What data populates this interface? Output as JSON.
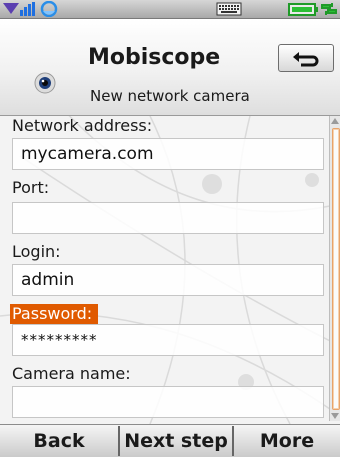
{
  "status_bar": {
    "icons": [
      "signal-strength-icon",
      "keyboard-icon",
      "battery-icon"
    ]
  },
  "header": {
    "title": "Mobiscope",
    "subtitle": "New network camera",
    "app_icon": "camera-eye-icon",
    "back_icon": "return-arrow-icon"
  },
  "form": {
    "fields": [
      {
        "label": "Network address:",
        "value": "mycamera.com"
      },
      {
        "label": "Port:",
        "value": ""
      },
      {
        "label": "Login:",
        "value": "admin"
      },
      {
        "label": "Password:",
        "value": "*********",
        "focused": true
      },
      {
        "label": "Camera name:",
        "value": ""
      }
    ]
  },
  "softkeys": {
    "left": "Back",
    "middle": "Next step",
    "right": "More"
  },
  "colors": {
    "focus_highlight": "#e05a00",
    "scroll_thumb_border": "#e8a36a"
  }
}
